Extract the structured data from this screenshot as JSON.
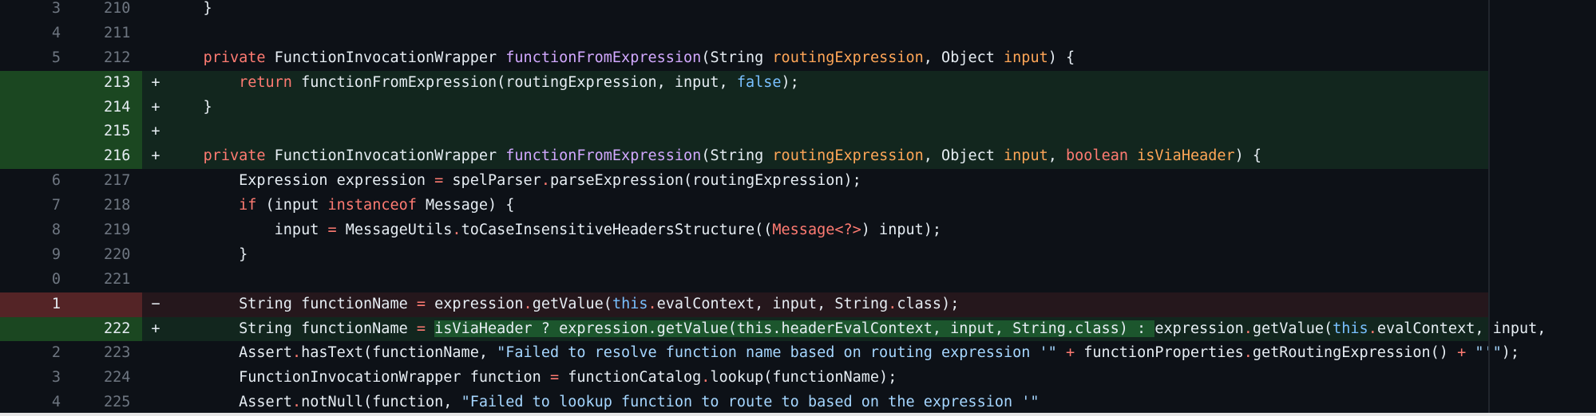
{
  "colors": {
    "background": "#0d1117",
    "added_row": "#12261e",
    "added_gutter": "#1b4721",
    "deleted_row": "#25171c",
    "deleted_gutter": "#542426",
    "keyword": "#ff7b72",
    "function": "#d2a8ff",
    "parameter": "#ffa657",
    "constant": "#79c0ff",
    "string": "#a5d6ff",
    "inline_highlight": "#2ea04366"
  },
  "diff": {
    "lines": [
      {
        "type": "context",
        "old": "3",
        "new": "210",
        "marker": "",
        "tokens": [
          {
            "t": "    }",
            "c": "plain"
          }
        ]
      },
      {
        "type": "context",
        "old": "4",
        "new": "211",
        "marker": "",
        "tokens": []
      },
      {
        "type": "context",
        "old": "5",
        "new": "212",
        "marker": "",
        "tokens": [
          {
            "t": "    ",
            "c": "plain"
          },
          {
            "t": "private",
            "c": "kw"
          },
          {
            "t": " FunctionInvocationWrapper ",
            "c": "plain"
          },
          {
            "t": "functionFromExpression",
            "c": "fn"
          },
          {
            "t": "(String ",
            "c": "plain"
          },
          {
            "t": "routingExpression",
            "c": "pa"
          },
          {
            "t": ", Object ",
            "c": "plain"
          },
          {
            "t": "input",
            "c": "pa"
          },
          {
            "t": ") {",
            "c": "plain"
          }
        ]
      },
      {
        "type": "add",
        "old": "",
        "new": "213",
        "marker": "+",
        "tokens": [
          {
            "t": "        ",
            "c": "plain"
          },
          {
            "t": "return",
            "c": "kw"
          },
          {
            "t": " functionFromExpression(routingExpression, input, ",
            "c": "plain"
          },
          {
            "t": "false",
            "c": "cn"
          },
          {
            "t": ");",
            "c": "plain"
          }
        ]
      },
      {
        "type": "add",
        "old": "",
        "new": "214",
        "marker": "+",
        "tokens": [
          {
            "t": "    }",
            "c": "plain"
          }
        ]
      },
      {
        "type": "add",
        "old": "",
        "new": "215",
        "marker": "+",
        "tokens": []
      },
      {
        "type": "add",
        "old": "",
        "new": "216",
        "marker": "+",
        "tokens": [
          {
            "t": "    ",
            "c": "plain"
          },
          {
            "t": "private",
            "c": "kw"
          },
          {
            "t": " FunctionInvocationWrapper ",
            "c": "plain"
          },
          {
            "t": "functionFromExpression",
            "c": "fn"
          },
          {
            "t": "(String ",
            "c": "plain"
          },
          {
            "t": "routingExpression",
            "c": "pa"
          },
          {
            "t": ", Object ",
            "c": "plain"
          },
          {
            "t": "input",
            "c": "pa"
          },
          {
            "t": ", ",
            "c": "plain"
          },
          {
            "t": "boolean",
            "c": "kw"
          },
          {
            "t": " ",
            "c": "plain"
          },
          {
            "t": "isViaHeader",
            "c": "pa"
          },
          {
            "t": ") {",
            "c": "plain"
          }
        ]
      },
      {
        "type": "context",
        "old": "6",
        "new": "217",
        "marker": "",
        "tokens": [
          {
            "t": "        Expression expression ",
            "c": "plain"
          },
          {
            "t": "=",
            "c": "op"
          },
          {
            "t": " spelParser",
            "c": "plain"
          },
          {
            "t": ".",
            "c": "op"
          },
          {
            "t": "parseExpression(routingExpression);",
            "c": "plain"
          }
        ]
      },
      {
        "type": "context",
        "old": "7",
        "new": "218",
        "marker": "",
        "tokens": [
          {
            "t": "        ",
            "c": "plain"
          },
          {
            "t": "if",
            "c": "kw"
          },
          {
            "t": " (input ",
            "c": "plain"
          },
          {
            "t": "instanceof",
            "c": "kw"
          },
          {
            "t": " Message) {",
            "c": "plain"
          }
        ]
      },
      {
        "type": "context",
        "old": "8",
        "new": "219",
        "marker": "",
        "tokens": [
          {
            "t": "            input ",
            "c": "plain"
          },
          {
            "t": "=",
            "c": "op"
          },
          {
            "t": " MessageUtils",
            "c": "plain"
          },
          {
            "t": ".",
            "c": "op"
          },
          {
            "t": "toCaseInsensitiveHeadersStructure((",
            "c": "plain"
          },
          {
            "t": "Message<?>",
            "c": "kw"
          },
          {
            "t": ") input);",
            "c": "plain"
          }
        ]
      },
      {
        "type": "context",
        "old": "9",
        "new": "220",
        "marker": "",
        "tokens": [
          {
            "t": "        }",
            "c": "plain"
          }
        ]
      },
      {
        "type": "context",
        "old": "0",
        "new": "221",
        "marker": "",
        "tokens": []
      },
      {
        "type": "del",
        "old": "1",
        "new": "",
        "marker": "−",
        "tokens": [
          {
            "t": "        String functionName ",
            "c": "plain"
          },
          {
            "t": "=",
            "c": "op"
          },
          {
            "t": " expression",
            "c": "plain"
          },
          {
            "t": ".",
            "c": "op"
          },
          {
            "t": "getValue(",
            "c": "plain"
          },
          {
            "t": "this",
            "c": "cn"
          },
          {
            "t": ".",
            "c": "op"
          },
          {
            "t": "evalContext, input, String",
            "c": "plain"
          },
          {
            "t": ".",
            "c": "op"
          },
          {
            "t": "class);",
            "c": "plain"
          }
        ]
      },
      {
        "type": "add",
        "old": "",
        "new": "222",
        "marker": "+",
        "tokens": [
          {
            "t": "        String functionName ",
            "c": "plain"
          },
          {
            "t": "=",
            "c": "op"
          },
          {
            "t": " ",
            "c": "plain"
          },
          {
            "t": "isViaHeader ? expression.getValue(this.headerEvalContext, input, String.class) : ",
            "c": "plain",
            "hl": true
          },
          {
            "t": "expression",
            "c": "plain"
          },
          {
            "t": ".",
            "c": "op"
          },
          {
            "t": "getValue(",
            "c": "plain"
          },
          {
            "t": "this",
            "c": "cn"
          },
          {
            "t": ".",
            "c": "op"
          },
          {
            "t": "evalContext, input,",
            "c": "plain"
          }
        ]
      },
      {
        "type": "context",
        "old": "2",
        "new": "223",
        "marker": "",
        "tokens": [
          {
            "t": "        Assert",
            "c": "plain"
          },
          {
            "t": ".",
            "c": "op"
          },
          {
            "t": "hasText(functionName, ",
            "c": "plain"
          },
          {
            "t": "\"Failed to resolve function name based on routing expression '\"",
            "c": "st"
          },
          {
            "t": " ",
            "c": "plain"
          },
          {
            "t": "+",
            "c": "op"
          },
          {
            "t": " functionProperties",
            "c": "plain"
          },
          {
            "t": ".",
            "c": "op"
          },
          {
            "t": "getRoutingExpression() ",
            "c": "plain"
          },
          {
            "t": "+",
            "c": "op"
          },
          {
            "t": " ",
            "c": "plain"
          },
          {
            "t": "\"'\"",
            "c": "st"
          },
          {
            "t": ");",
            "c": "plain"
          }
        ]
      },
      {
        "type": "context",
        "old": "3",
        "new": "224",
        "marker": "",
        "tokens": [
          {
            "t": "        FunctionInvocationWrapper function ",
            "c": "plain"
          },
          {
            "t": "=",
            "c": "op"
          },
          {
            "t": " functionCatalog",
            "c": "plain"
          },
          {
            "t": ".",
            "c": "op"
          },
          {
            "t": "lookup(functionName);",
            "c": "plain"
          }
        ]
      },
      {
        "type": "context",
        "old": "4",
        "new": "225",
        "marker": "",
        "tokens": [
          {
            "t": "        Assert",
            "c": "plain"
          },
          {
            "t": ".",
            "c": "op"
          },
          {
            "t": "notNull(function, ",
            "c": "plain"
          },
          {
            "t": "\"Failed to lookup function to route to based on the expression '\"",
            "c": "st"
          }
        ]
      }
    ]
  }
}
